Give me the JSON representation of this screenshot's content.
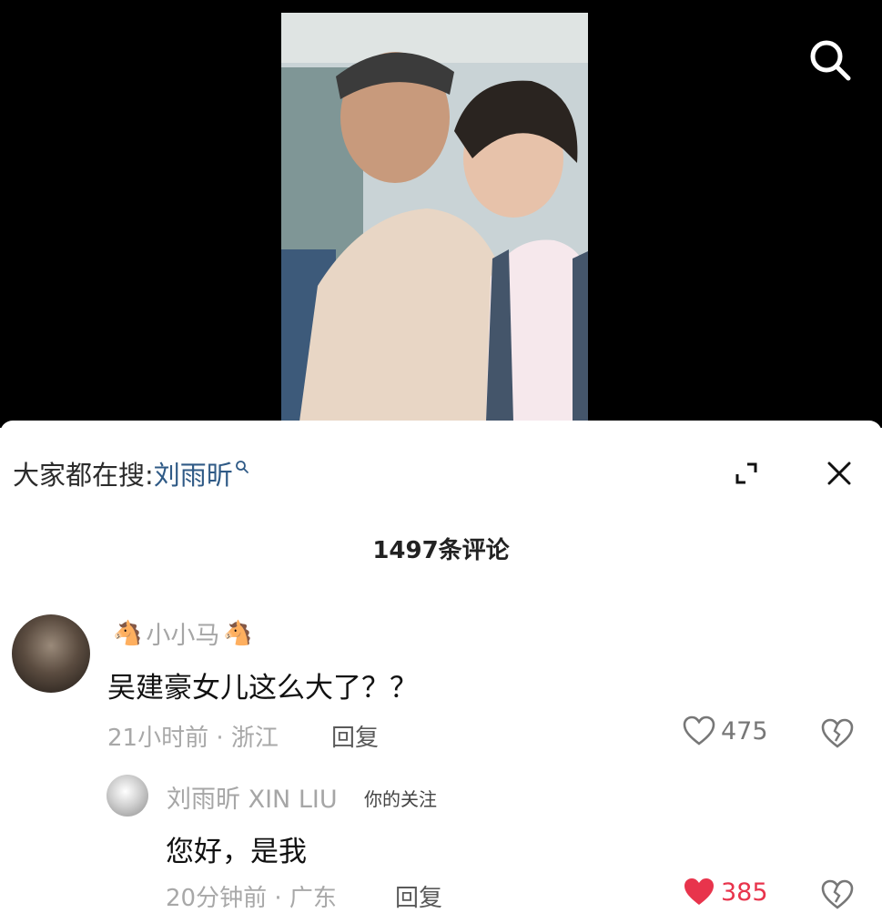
{
  "trending": {
    "prefix": "大家都在搜:",
    "term": "刘雨昕"
  },
  "comments_count": "1497条评论",
  "comments": [
    {
      "username": "小小马",
      "text": "吴建豪女儿这么大了？？",
      "time_location": "21小时前 · 浙江",
      "reply_label": "回复",
      "likes": "475"
    },
    {
      "username": "刘雨昕 XIN LIU",
      "tag": "你的关注",
      "text": "您好，是我",
      "time_location": "20分钟前 · 广东",
      "reply_label": "回复",
      "likes": "385"
    }
  ],
  "icons": {
    "search": "search-icon",
    "expand": "expand-icon",
    "close": "close-icon",
    "heart": "heart-icon",
    "broken_heart": "broken-heart-icon",
    "horse": "horse-emoji"
  },
  "colors": {
    "link": "#2f5a86",
    "liked": "#e8344c"
  }
}
